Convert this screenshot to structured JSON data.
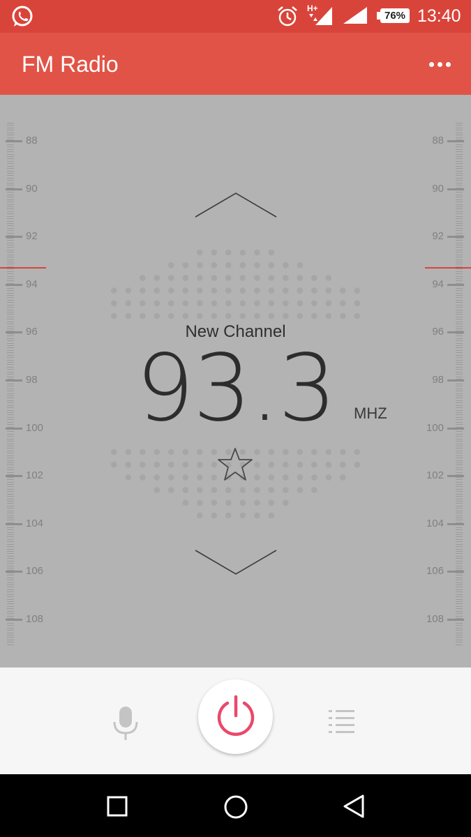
{
  "status_bar": {
    "battery": "76%",
    "time": "13:40",
    "network": "H+",
    "icons": [
      "whatsapp-icon",
      "alarm-icon",
      "mobile-data-icon",
      "signal-icon",
      "battery-icon"
    ]
  },
  "app_bar": {
    "title": "FM Radio",
    "menu_icon": "more-options-icon"
  },
  "tuner": {
    "scale_labels": [
      "88",
      "90",
      "92",
      "94",
      "96",
      "98",
      "100",
      "102",
      "104",
      "106",
      "108"
    ],
    "indicator_color": "#d9443a"
  },
  "station": {
    "name": "New Channel",
    "frequency": "93.3",
    "unit": "MHZ",
    "favorite": false
  },
  "controls": {
    "record_icon": "microphone-icon",
    "power_icon": "power-icon",
    "list_icon": "station-list-icon",
    "power_color": "#e84a6a"
  },
  "nav_bar": {
    "icons": [
      "recent-apps-icon",
      "home-icon",
      "back-icon"
    ]
  },
  "colors": {
    "status_bar": "#d9443a",
    "app_bar": "#e15346",
    "tuner_bg": "#b3b3b3",
    "controls_bg": "#f6f6f6"
  }
}
